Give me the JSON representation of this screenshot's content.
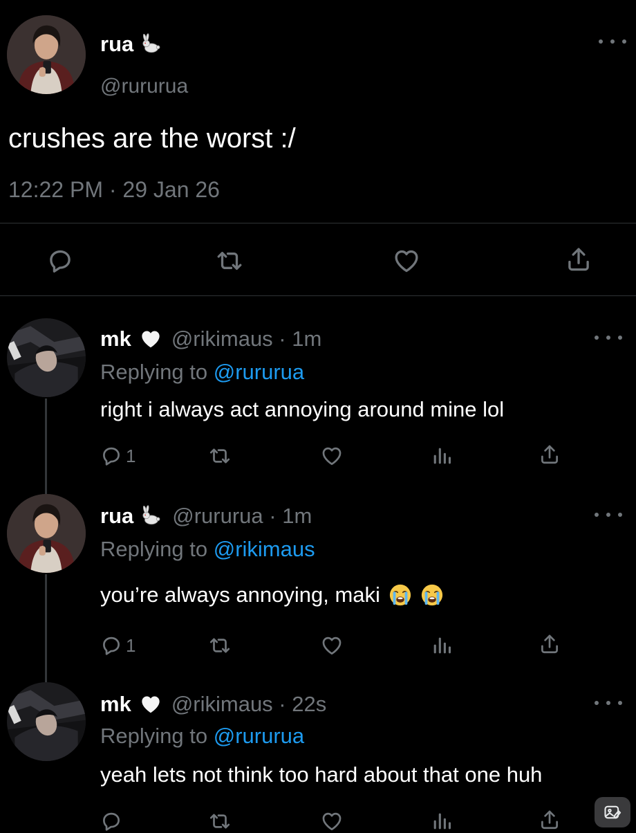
{
  "main_tweet": {
    "author_name": "rua",
    "author_emoji": "🐇",
    "handle": "@rururua",
    "text": "crushes are the worst :/",
    "meta": "12:22 PM · 29 Jan 26"
  },
  "icons": {
    "reply": "reply-icon",
    "retweet": "retweet-icon",
    "like": "heart-icon",
    "views": "views-icon",
    "share": "share-icon",
    "more": "more-icon"
  },
  "replies": [
    {
      "name": "mk",
      "handle_time": "@rikimaus · 1m",
      "replying_prefix": "Replying to",
      "replying_to": "@rururua",
      "text": "right i always act annoying around mine lol",
      "reply_count": "1"
    },
    {
      "name": "rua",
      "handle_time": "@rururua · 1m",
      "replying_prefix": "Replying to",
      "replying_to": "@rikimaus",
      "text": "you’re always annoying, maki",
      "reply_count": "1"
    },
    {
      "name": "mk",
      "handle_time": "@rikimaus · 22s",
      "replying_prefix": "Replying to",
      "replying_to": "@rururua",
      "text": "yeah lets not think too hard about that one huh",
      "reply_count": ""
    }
  ],
  "colors": {
    "background": "#000000",
    "text": "#e7e9ea",
    "muted": "#71767b",
    "link": "#1d9bf0",
    "divider": "#2f3336"
  }
}
